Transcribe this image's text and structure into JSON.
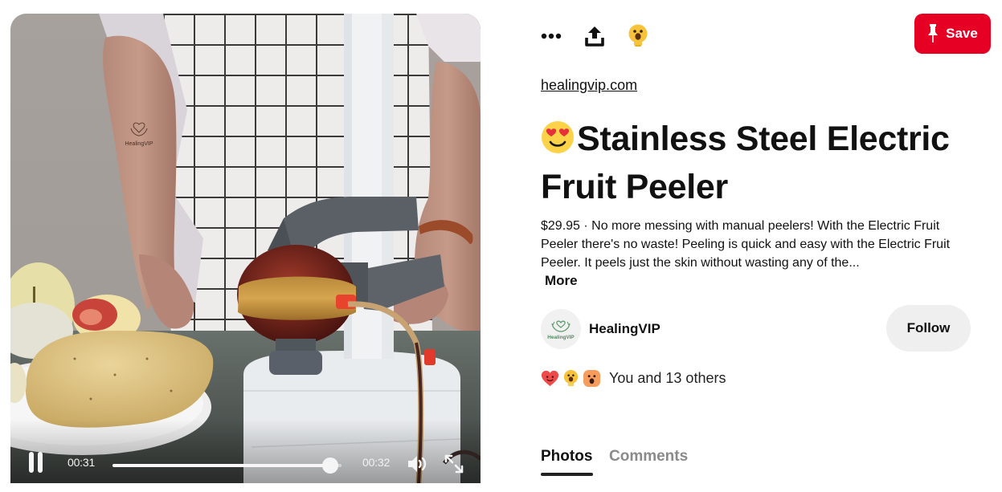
{
  "video": {
    "current_time": "00:31",
    "duration": "00:32",
    "progress_fraction": 0.95,
    "playing": true,
    "watermark_text": "HealingVIP"
  },
  "toolbar": {
    "more_icon": "ellipsis-icon",
    "share_icon": "share-upload-icon",
    "reaction_icon": "wow-reaction-icon",
    "save_label": "Save",
    "save_icon": "pushpin-icon"
  },
  "pin": {
    "source": "healingvip.com",
    "title_emoji": "heart-eyes-emoji",
    "title": "Stainless Steel Electric Fruit Peeler",
    "description": "$29.95 · No more messing with manual peelers! With the Electric Fruit Peeler there's no waste! Peeling is quick and easy with the Electric Fruit Peeler. It peels just the skin without wasting any of the...",
    "more_label": "More"
  },
  "creator": {
    "name": "HealingVIP",
    "avatar_text": "HealingVIP",
    "follow_label": "Follow"
  },
  "reactions": {
    "icons": [
      "heart-face-icon",
      "lightbulb-wow-icon",
      "surprised-face-icon"
    ],
    "summary": "You and 13 others"
  },
  "tabs": [
    {
      "label": "Photos",
      "active": true
    },
    {
      "label": "Comments",
      "active": false
    }
  ],
  "colors": {
    "brand_red": "#e60023",
    "follow_bg": "#efefef",
    "inactive_tab": "#8a8a8a"
  }
}
